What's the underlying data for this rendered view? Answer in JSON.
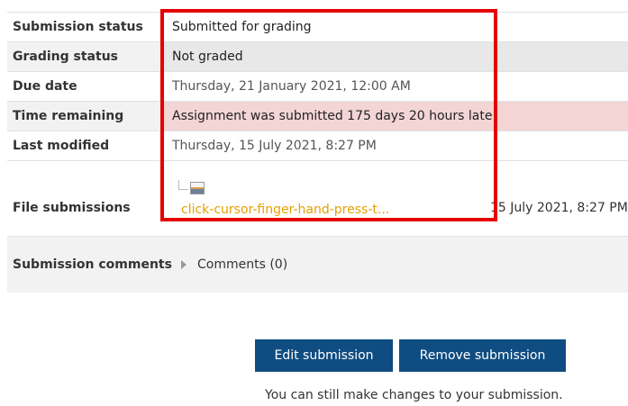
{
  "status_table": {
    "rows": [
      {
        "label": "Submission status",
        "value": "Submitted for grading"
      },
      {
        "label": "Grading status",
        "value": "Not graded"
      },
      {
        "label": "Due date",
        "value": "Thursday, 21 January 2021, 12:00 AM"
      },
      {
        "label": "Time remaining",
        "value": "Assignment was submitted 175 days 20 hours late"
      },
      {
        "label": "Last modified",
        "value": "Thursday, 15 July 2021, 8:27 PM"
      }
    ],
    "file_submissions": {
      "label": "File submissions",
      "file_name": "click-cursor-finger-hand-press-t...",
      "file_date": "15 July 2021, 8:27 PM",
      "file_icon": "image-file-icon"
    }
  },
  "comments": {
    "label": "Submission comments",
    "toggle_label": "Comments (0)",
    "toggle_icon": "collapsed-triangle-icon"
  },
  "actions": {
    "edit_label": "Edit submission",
    "remove_label": "Remove submission",
    "hint": "You can still make changes to your submission."
  },
  "colors": {
    "button_bg": "#0f4c81",
    "late_bg": "#f3d5d6",
    "file_link": "#e6a000",
    "highlight_box": "#e60000"
  }
}
